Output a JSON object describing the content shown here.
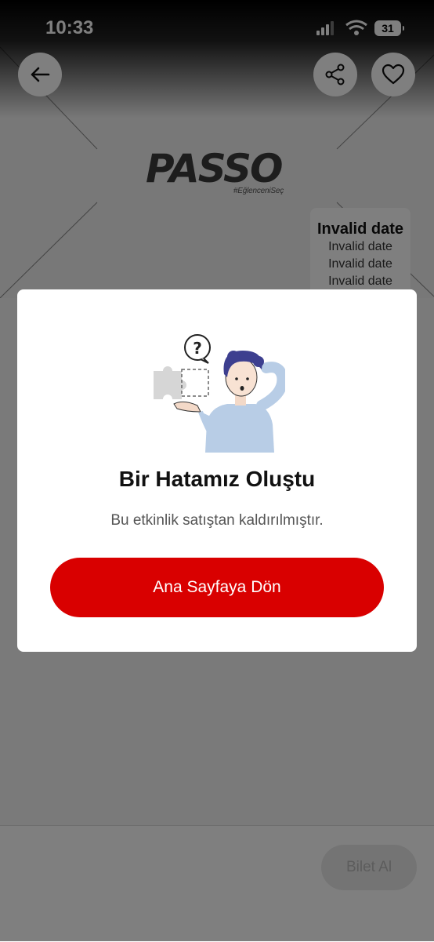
{
  "status_bar": {
    "time": "10:33",
    "battery": "31"
  },
  "header": {
    "back_icon": "arrow-left-icon",
    "share_icon": "share-icon",
    "favorite_icon": "heart-icon"
  },
  "hero": {
    "logo_text": "PASSO",
    "logo_tagline": "#EğlenceniSeç",
    "date_main": "Invalid date",
    "date_lines": [
      "Invalid date",
      "Invalid date",
      "Invalid date"
    ]
  },
  "footer": {
    "buy_label": "Bilet Al"
  },
  "modal": {
    "illustration": "confused-person-puzzle-illustration",
    "title": "Bir Hatamız Oluştu",
    "message": "Bu etkinlik satıştan kaldırılmıştır.",
    "button_label": "Ana Sayfaya Dön"
  },
  "colors": {
    "accent": "#d90000",
    "overlay": "rgba(0,0,0,0.5)"
  }
}
